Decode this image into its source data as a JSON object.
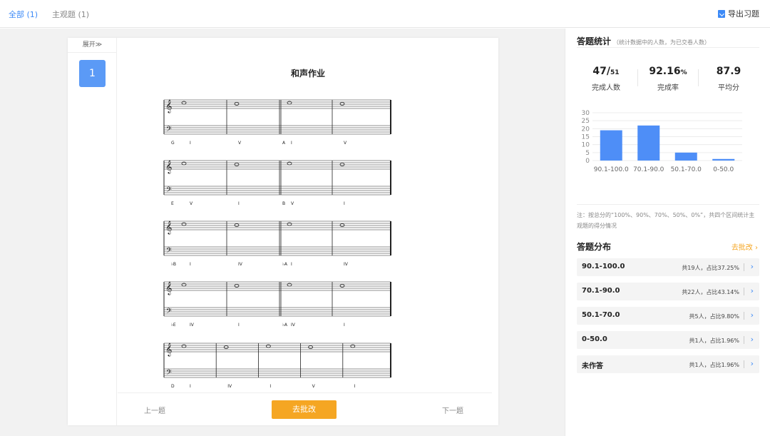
{
  "tabs": [
    {
      "label": "全部 (1)",
      "active": true
    },
    {
      "label": "主观题 (1)",
      "active": false
    }
  ],
  "export_label": "导出习题",
  "nav": {
    "expand_label": "展开≫",
    "question_number": "1"
  },
  "homework": {
    "title": "和声作业",
    "systems": [
      {
        "key_marks": [
          "G",
          "A"
        ],
        "chords": [
          "I",
          "V",
          "I",
          "V"
        ]
      },
      {
        "key_marks": [
          "E",
          "B"
        ],
        "chords": [
          "V",
          "I",
          "V",
          "I"
        ]
      },
      {
        "key_marks": [
          "♭B",
          "♭A"
        ],
        "chords": [
          "I",
          "IV",
          "I",
          "IV"
        ]
      },
      {
        "key_marks": [
          "♭E",
          "♭A"
        ],
        "chords": [
          "IV",
          "I",
          "IV",
          "I"
        ]
      },
      {
        "key_marks": [
          "D"
        ],
        "chords": [
          "I",
          "IV",
          "I",
          "V",
          "I"
        ]
      }
    ]
  },
  "footer": {
    "prev": "上一题",
    "grade": "去批改",
    "next": "下一题"
  },
  "stats": {
    "title": "答题统计",
    "subtitle": "（统计数据中的人数，为已交卷人数）",
    "completed_main": "47/",
    "completed_total": "51",
    "completed_label": "完成人数",
    "rate_value": "92.16",
    "rate_unit": "%",
    "rate_label": "完成率",
    "avg_value": "87.9",
    "avg_label": "平均分"
  },
  "chart_data": {
    "type": "bar",
    "categories": [
      "90.1-100.0",
      "70.1-90.0",
      "50.1-70.0",
      "0-50.0"
    ],
    "values": [
      19,
      22,
      5,
      1
    ],
    "ylim": [
      0,
      30
    ],
    "yticks": [
      "0",
      "5",
      "10",
      "15",
      "20",
      "25",
      "30"
    ],
    "grid": true,
    "bar_color": "#4e8ef7"
  },
  "note": "注：按总分的“100%、90%、70%、50%、0%”，共四个区间统计主观题的得分情况",
  "distribution": {
    "title": "答题分布",
    "link": "去批改",
    "rows": [
      {
        "label": "90.1-100.0",
        "stat": "共19人，占比37.25%"
      },
      {
        "label": "70.1-90.0",
        "stat": "共22人，占比43.14%"
      },
      {
        "label": "50.1-70.0",
        "stat": "共5人，占比9.80%"
      },
      {
        "label": "0-50.0",
        "stat": "共1人，占比1.96%"
      },
      {
        "label": "未作答",
        "stat": "共1人，占比1.96%"
      }
    ]
  },
  "colors": {
    "accent": "#3d8af7",
    "orange": "#f5a623"
  }
}
